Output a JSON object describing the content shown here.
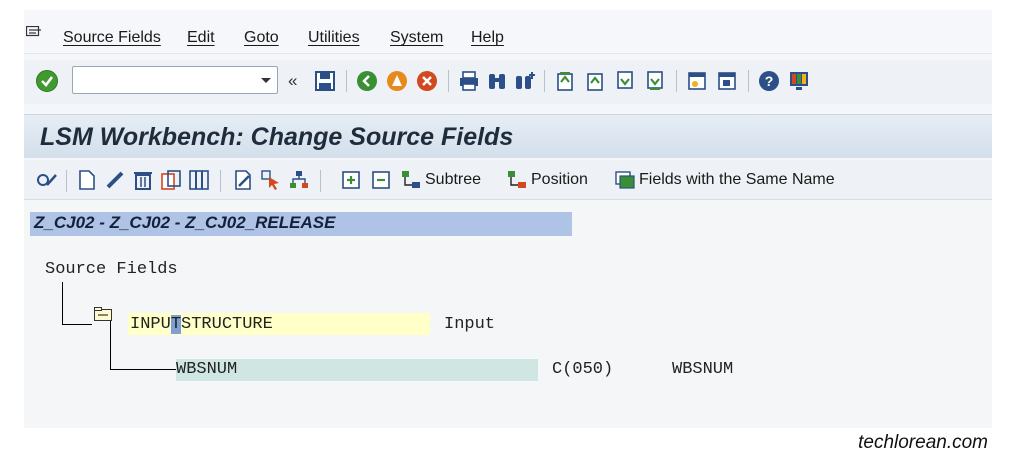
{
  "menu": {
    "items": [
      "Source Fields",
      "Edit",
      "Goto",
      "Utilities",
      "System",
      "Help"
    ]
  },
  "toolbar": {
    "command_field_value": "",
    "back_glyph": "«"
  },
  "title": "LSM Workbench: Change Source Fields",
  "app_toolbar": {
    "subtree_label": "Subtree",
    "position_label": "Position",
    "same_name_label": "Fields with the Same Name"
  },
  "hierarchy": {
    "object_path": "Z_CJ02 - Z_CJ02 - Z_CJ02_RELEASE",
    "root_label": "Source Fields",
    "structure": {
      "name_before_cursor": "INPU",
      "name_cursor_char": "T",
      "name_after_cursor": "STRUCTURE",
      "type": "Input"
    },
    "field": {
      "name": "WBSNUM",
      "format": "C(050)",
      "description": "WBSNUM"
    }
  },
  "watermark": "techlorean.com",
  "colors": {
    "structure_highlight": "#ffffc8",
    "field_highlight": "#cfe6e3",
    "cursor_highlight": "#7f9ed6",
    "path_banner": "#afc3e6"
  }
}
